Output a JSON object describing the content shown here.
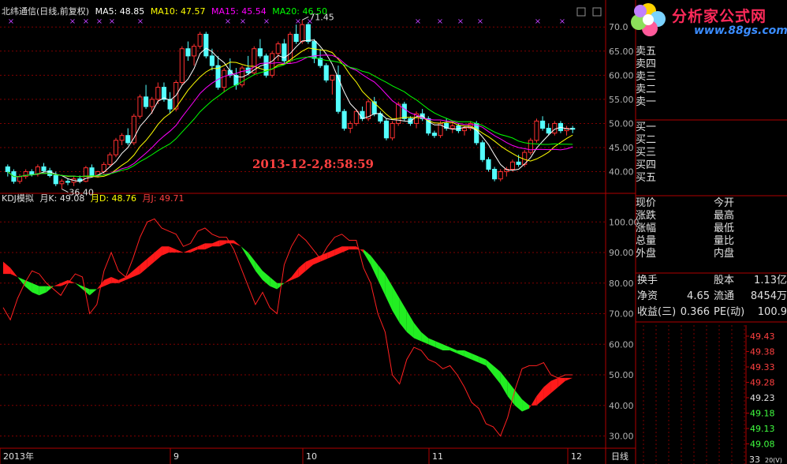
{
  "header": {
    "title": "北纬通信(日线,前复权)",
    "ma5": "MA5: 48.85",
    "ma10": "MA10: 47.57",
    "ma15": "MA15: 45.54",
    "ma20": "MA20: 46.50"
  },
  "price_panel": {
    "high_marker": "71.45",
    "low_marker": "36.40",
    "cursor_time": "2013-12-2,8:58:59",
    "y_ticks": [
      "70.0",
      "65.00",
      "60.00",
      "55.00",
      "50.00",
      "45.00",
      "40.00"
    ]
  },
  "kdj_panel": {
    "title": "KDJ模拟",
    "k": "月K: 49.08",
    "d": "月D: 48.76",
    "j": "月J: 49.71",
    "y_ticks": [
      "100.00",
      "90.00",
      "80.00",
      "70.00",
      "60.00",
      "50.00",
      "40.00",
      "30.00"
    ]
  },
  "x_axis": {
    "labels": [
      "2013年",
      "9",
      "10",
      "11",
      "12"
    ],
    "period": "日线"
  },
  "logo": {
    "name": "分析家公式网",
    "url": "www.88gs.com"
  },
  "orderbook": {
    "sell": [
      "卖五",
      "卖四",
      "卖三",
      "卖二",
      "卖一"
    ],
    "buy": [
      "买一",
      "买二",
      "买三",
      "买四",
      "买五"
    ]
  },
  "stats": {
    "left": [
      "现价",
      "涨跌",
      "涨幅",
      "总量",
      "外盘"
    ],
    "right": [
      "今开",
      "最高",
      "最低",
      "量比",
      "内盘"
    ]
  },
  "info": {
    "row1": {
      "l": "换手",
      "m": "股本",
      "v": "1.13亿"
    },
    "row2": {
      "l": "净资",
      "lv": "4.65",
      "m": "流通",
      "v": "8454万"
    },
    "row3": {
      "l": "收益(三)",
      "lv": "0.366",
      "m": "PE(动)",
      "v": "100.9"
    }
  },
  "mini_axis": {
    "labels": [
      "49.43",
      "49.38",
      "49.33",
      "49.28",
      "49.23",
      "49.18",
      "49.13",
      "49.08"
    ],
    "bottom_left": "33",
    "bottom_right": "20(V)"
  },
  "colors": {
    "up": "#ff3030",
    "down": "#54ffff",
    "ma5": "#ffffff",
    "ma10": "#ffff00",
    "ma15": "#ff00ff",
    "ma20": "#00ff00",
    "grid": "#800000",
    "axis": "#b00000"
  },
  "chart_data": [
    {
      "type": "candlestick",
      "name": "北纬通信",
      "candles": [
        [
          41.0,
          41.5,
          39.0,
          40.0
        ],
        [
          40.0,
          40.5,
          37.5,
          38.0
        ],
        [
          38.0,
          39.5,
          37.5,
          39.0
        ],
        [
          39.0,
          40.5,
          38.5,
          40.0
        ],
        [
          40.0,
          40.5,
          39.0,
          39.5
        ],
        [
          39.5,
          41.5,
          39.0,
          41.0
        ],
        [
          41.0,
          41.8,
          39.8,
          40.2
        ],
        [
          40.2,
          40.8,
          38.8,
          39.2
        ],
        [
          39.2,
          40.0,
          37.0,
          37.5
        ],
        [
          37.5,
          38.5,
          36.4,
          38.0
        ],
        [
          38.0,
          38.6,
          37.2,
          37.8
        ],
        [
          37.8,
          39.0,
          37.0,
          38.5
        ],
        [
          38.5,
          39.2,
          37.6,
          38.0
        ],
        [
          38.0,
          41.2,
          37.8,
          40.8
        ],
        [
          40.8,
          41.5,
          39.0,
          39.2
        ],
        [
          39.2,
          40.2,
          38.8,
          40.0
        ],
        [
          40.0,
          42.0,
          39.5,
          41.5
        ],
        [
          41.5,
          44.0,
          41.0,
          43.5
        ],
        [
          43.5,
          47.0,
          43.0,
          46.5
        ],
        [
          46.5,
          48.0,
          45.5,
          47.5
        ],
        [
          47.5,
          49.0,
          45.5,
          46.0
        ],
        [
          46.0,
          52.0,
          45.5,
          51.5
        ],
        [
          51.5,
          56.0,
          51.0,
          55.5
        ],
        [
          55.5,
          58.0,
          53.0,
          53.5
        ],
        [
          53.5,
          55.5,
          52.0,
          55.0
        ],
        [
          55.0,
          58.5,
          54.0,
          57.5
        ],
        [
          57.5,
          58.5,
          54.5,
          55.0
        ],
        [
          55.0,
          56.5,
          52.0,
          53.0
        ],
        [
          53.0,
          59.0,
          52.5,
          58.5
        ],
        [
          58.5,
          66.0,
          58.0,
          65.5
        ],
        [
          65.5,
          67.0,
          63.0,
          64.0
        ],
        [
          64.0,
          66.5,
          62.0,
          66.0
        ],
        [
          66.0,
          69.0,
          65.5,
          68.5
        ],
        [
          68.5,
          69.0,
          63.5,
          64.0
        ],
        [
          64.0,
          65.5,
          61.0,
          62.0
        ],
        [
          62.0,
          64.0,
          57.0,
          57.5
        ],
        [
          57.5,
          61.5,
          56.5,
          61.0
        ],
        [
          61.0,
          63.5,
          59.5,
          60.0
        ],
        [
          60.0,
          61.5,
          57.0,
          58.0
        ],
        [
          58.0,
          62.0,
          57.5,
          61.5
        ],
        [
          61.5,
          64.0,
          60.0,
          60.5
        ],
        [
          60.5,
          66.0,
          60.0,
          65.5
        ],
        [
          65.5,
          67.5,
          63.5,
          64.0
        ],
        [
          64.0,
          64.5,
          59.5,
          60.0
        ],
        [
          60.0,
          65.0,
          59.5,
          64.5
        ],
        [
          64.5,
          67.0,
          63.0,
          66.5
        ],
        [
          66.5,
          67.5,
          62.5,
          63.0
        ],
        [
          63.0,
          69.0,
          62.5,
          68.5
        ],
        [
          68.5,
          70.5,
          66.5,
          67.0
        ],
        [
          67.0,
          71.45,
          66.5,
          70.5
        ],
        [
          70.5,
          71.0,
          66.5,
          67.0
        ],
        [
          67.0,
          67.5,
          62.5,
          63.5
        ],
        [
          63.5,
          65.5,
          61.5,
          62.0
        ],
        [
          62.0,
          62.5,
          58.5,
          59.0
        ],
        [
          59.0,
          60.0,
          56.0,
          60.0
        ],
        [
          60.0,
          62.0,
          52.0,
          52.5
        ],
        [
          52.5,
          53.0,
          48.5,
          49.0
        ],
        [
          49.0,
          50.5,
          48.0,
          50.0
        ],
        [
          50.0,
          53.0,
          49.5,
          52.5
        ],
        [
          52.5,
          53.5,
          50.5,
          51.0
        ],
        [
          51.0,
          55.0,
          50.5,
          54.5
        ],
        [
          54.5,
          55.5,
          51.5,
          52.0
        ],
        [
          52.0,
          52.5,
          50.0,
          50.5
        ],
        [
          50.5,
          51.0,
          46.5,
          47.0
        ],
        [
          47.0,
          50.5,
          46.5,
          50.0
        ],
        [
          50.0,
          54.5,
          49.5,
          54.0
        ],
        [
          54.0,
          54.5,
          50.5,
          51.0
        ],
        [
          51.0,
          51.5,
          49.5,
          50.0
        ],
        [
          50.0,
          52.5,
          49.0,
          52.0
        ],
        [
          52.0,
          53.0,
          50.5,
          51.0
        ],
        [
          51.0,
          51.5,
          47.5,
          48.0
        ],
        [
          48.0,
          48.5,
          47.0,
          47.5
        ],
        [
          47.5,
          50.5,
          47.0,
          50.0
        ],
        [
          50.0,
          51.0,
          48.5,
          49.0
        ],
        [
          49.0,
          50.5,
          48.0,
          49.5
        ],
        [
          49.5,
          50.0,
          48.0,
          48.5
        ],
        [
          48.5,
          49.5,
          47.5,
          49.0
        ],
        [
          49.0,
          50.5,
          48.5,
          50.0
        ],
        [
          50.0,
          50.5,
          45.5,
          46.0
        ],
        [
          46.0,
          46.5,
          42.0,
          42.5
        ],
        [
          42.5,
          43.0,
          40.0,
          40.5
        ],
        [
          40.5,
          41.0,
          38.0,
          38.5
        ],
        [
          38.5,
          40.5,
          38.0,
          40.0
        ],
        [
          40.0,
          41.0,
          39.0,
          40.5
        ],
        [
          40.5,
          42.5,
          40.0,
          42.0
        ],
        [
          42.0,
          43.5,
          41.0,
          41.5
        ],
        [
          41.5,
          44.5,
          41.0,
          44.0
        ],
        [
          44.0,
          47.0,
          43.5,
          46.5
        ],
        [
          46.5,
          51.0,
          46.0,
          50.5
        ],
        [
          50.5,
          51.5,
          48.5,
          49.0
        ],
        [
          49.0,
          50.0,
          47.5,
          48.0
        ],
        [
          48.0,
          50.5,
          47.5,
          50.0
        ],
        [
          50.0,
          50.5,
          48.0,
          48.5
        ],
        [
          48.5,
          49.5,
          47.5,
          49.0
        ],
        [
          49.0,
          49.5,
          48.0,
          48.8
        ]
      ],
      "ylim": [
        36.0,
        72.0
      ]
    },
    {
      "type": "line",
      "title": "KDJ模拟",
      "series": [
        {
          "name": "月K",
          "values": [
            87,
            85,
            82,
            79,
            77,
            76,
            77,
            79,
            80,
            81,
            80,
            78,
            76,
            78,
            81,
            82,
            81,
            82,
            84,
            86,
            88,
            90,
            92,
            92,
            91,
            90,
            91,
            92,
            93,
            93,
            94,
            94,
            94,
            92,
            88,
            84,
            81,
            79,
            78,
            80,
            82,
            85,
            87,
            88,
            89,
            90,
            91,
            92,
            92,
            92,
            90,
            86,
            81,
            76,
            71,
            67,
            64,
            62,
            61,
            60,
            59,
            58,
            58,
            57,
            56,
            55,
            54,
            53,
            50,
            47,
            43,
            40,
            38,
            39,
            43,
            46,
            48,
            49,
            49,
            49
          ]
        },
        {
          "name": "月D",
          "values": [
            83,
            83,
            82,
            81,
            80,
            79,
            79,
            79,
            79,
            80,
            80,
            79,
            78,
            78,
            79,
            80,
            80,
            81,
            82,
            83,
            85,
            87,
            89,
            90,
            90,
            90,
            90,
            91,
            91,
            92,
            92,
            93,
            93,
            92,
            90,
            87,
            84,
            82,
            80,
            80,
            81,
            82,
            84,
            86,
            87,
            88,
            89,
            90,
            91,
            91,
            91,
            89,
            86,
            83,
            79,
            75,
            71,
            67,
            64,
            62,
            61,
            60,
            59,
            58,
            58,
            57,
            56,
            55,
            53,
            51,
            48,
            45,
            42,
            40,
            40,
            42,
            44,
            46,
            48,
            49
          ]
        },
        {
          "name": "月J",
          "values": [
            72,
            68,
            75,
            80,
            84,
            83,
            80,
            78,
            76,
            80,
            83,
            82,
            70,
            73,
            84,
            90,
            84,
            82,
            88,
            95,
            100,
            101,
            98,
            97,
            96,
            92,
            93,
            97,
            98,
            96,
            95,
            95,
            91,
            85,
            79,
            73,
            77,
            72,
            70,
            86,
            92,
            96,
            94,
            91,
            88,
            92,
            95,
            96,
            94,
            94,
            85,
            80,
            70,
            64,
            50,
            47,
            55,
            59,
            58,
            55,
            54,
            52,
            53,
            50,
            46,
            41,
            39,
            34,
            33,
            30,
            36,
            45,
            52,
            53,
            53,
            54,
            50,
            49,
            50,
            50
          ]
        }
      ],
      "ylim": [
        26.0,
        106.0
      ]
    }
  ]
}
